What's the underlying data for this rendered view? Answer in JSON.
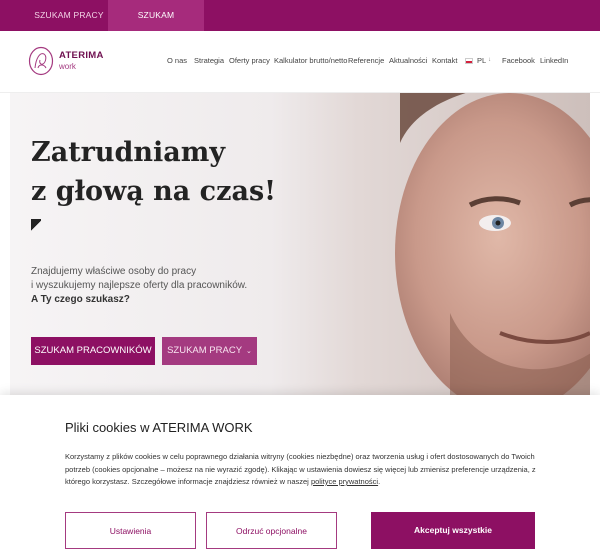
{
  "topbar": {
    "tabs": [
      {
        "label": "SZUKAM PRACY",
        "active": false
      },
      {
        "label": "SZUKAM PRACOWNIKA",
        "active": true
      }
    ]
  },
  "header": {
    "brand": "ATERIMA",
    "brand_sub": "work",
    "nav": [
      {
        "label": "O nas"
      },
      {
        "label": "Strategia"
      },
      {
        "label": "Oferty pracy"
      },
      {
        "label": "Kalkulator brutto/netto"
      },
      {
        "label": "Referencje"
      },
      {
        "label": "Aktualności"
      },
      {
        "label": "Kontakt"
      },
      {
        "label": "PL"
      },
      {
        "label": "Facebook"
      },
      {
        "label": "LinkedIn"
      }
    ],
    "flag_icon": "flag-pl-icon",
    "lang_chevron": "chevron-down-icon"
  },
  "hero": {
    "title_line1": "Zatrudniamy",
    "title_line2": "z głową na czas!",
    "text_line1": "Znajdujemy właściwe osoby do pracy",
    "text_line2": "i wyszukujemy najlepsze oferty dla pracowników.",
    "text_line3": "A Ty czego szukasz?",
    "btn_primary": "SZUKAM PRACOWNIKÓW",
    "btn_secondary": "SZUKAM PRACY",
    "btn_secondary_icon": "chevron-down-icon"
  },
  "cookie": {
    "title": "Pliki cookies w ATERIMA WORK",
    "text": "Korzystamy z plików cookies w celu poprawnego działania witryny (cookies niezbędne) oraz tworzenia usług i ofert dostosowanych do Twoich potrzeb (cookies opcjonalne – możesz na nie wyrazić zgodę). Klikając w ustawienia dowiesz się więcej lub zmienisz preferencje urządzenia, z którego korzystasz. Szczegółowe informacje znajdziesz również w naszej",
    "link": "polityce prywatności",
    "link_suffix": ".",
    "btn_settings": "Ustawienia",
    "btn_reject": "Odrzuć opcjonalne",
    "btn_accept": "Akceptuj wszystkie"
  },
  "colors": {
    "brand": "#8d1063",
    "brand_light": "#a43a80"
  }
}
